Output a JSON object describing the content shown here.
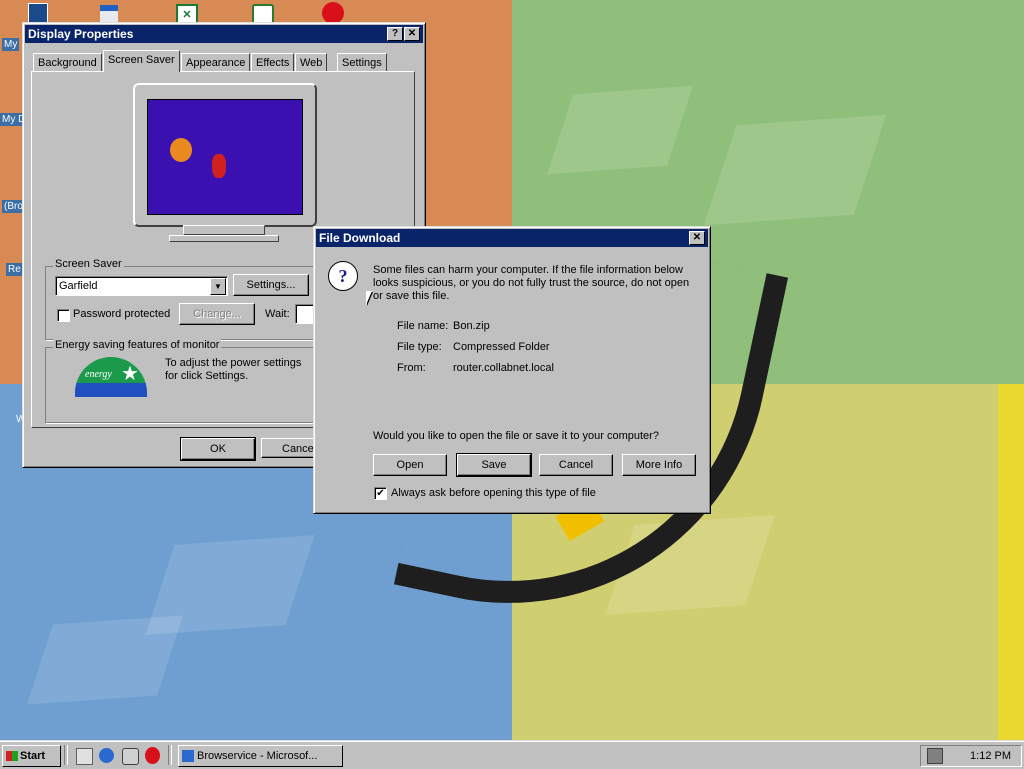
{
  "colors": {
    "titlebar": "#0a246a",
    "face": "#c0c0c0",
    "preview": "#3a10b0"
  },
  "desktop": {
    "icons": [
      {
        "name": "my-documents-icon",
        "label": "My"
      },
      {
        "name": "my-computer-icon",
        "label": "My D"
      },
      {
        "name": "browser-icon",
        "label": "(Bro"
      },
      {
        "name": "recycle-bin-icon",
        "label": "Re"
      },
      {
        "name": "desktop-icon",
        "label": "W"
      }
    ]
  },
  "display_properties": {
    "title": "Display Properties",
    "help": "?",
    "close": "✕",
    "tabs": [
      "Background",
      "Screen Saver",
      "Appearance",
      "Effects",
      "Web",
      "Settings"
    ],
    "active_tab": "Screen Saver",
    "screensaver_group": "Screen Saver",
    "screensaver_value": "Garfield",
    "settings_button": "Settings...",
    "password_label": "Password protected",
    "change_button": "Change...",
    "wait_label": "Wait:",
    "energy_group": "Energy saving features of monitor",
    "energy_text": "To adjust the power settings for click Settings.",
    "energy_logo_text": "energy",
    "ok_button": "OK",
    "cancel_button": "Cance"
  },
  "file_download": {
    "title": "File Download",
    "close": "✕",
    "warning": "Some files can harm your computer. If the file information below looks suspicious, or you do not fully trust the source, do not open or save this file.",
    "file_name_label": "File name:",
    "file_name": "Bon.zip",
    "file_type_label": "File type:",
    "file_type": "Compressed Folder",
    "from_label": "From:",
    "from": "router.collabnet.local",
    "question": "Would you like to open the file or save it to your computer?",
    "open_button": "Open",
    "save_button": "Save",
    "cancel_button": "Cancel",
    "more_info_button": "More Info",
    "always_ask_label": "Always ask before opening this type of file",
    "always_ask_checked": "✔"
  },
  "taskbar": {
    "start": "Start",
    "task": "Browservice - Microsof...",
    "clock": "1:12 PM"
  }
}
